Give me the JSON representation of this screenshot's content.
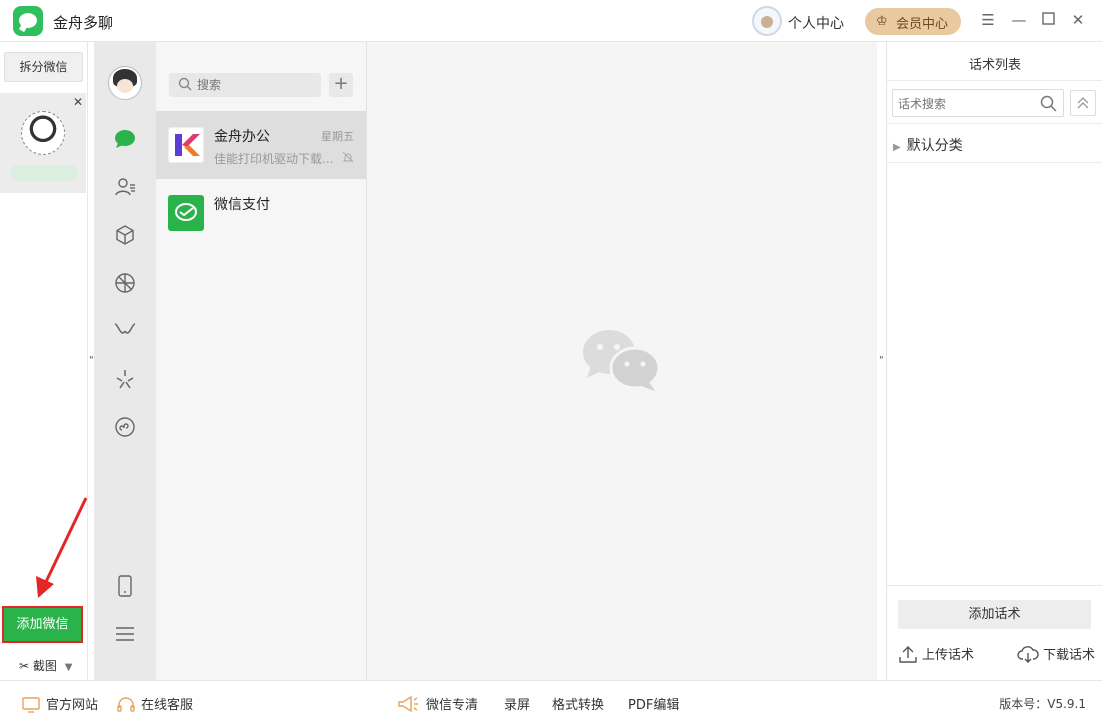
{
  "window": {
    "title": "金舟多聊",
    "personal_center": "个人中心",
    "vip_center": "会员中心"
  },
  "accounts": {
    "split_label": "拆分微信",
    "add_wechat": "添加微信",
    "screenshot": "截图"
  },
  "chatlist": {
    "search_placeholder": "搜索",
    "items": [
      {
        "name": "金舟办公",
        "preview": "佳能打印机驱动下载...",
        "time": "星期五"
      },
      {
        "name": "微信支付",
        "preview": "",
        "time": ""
      }
    ]
  },
  "phrases": {
    "title": "话术列表",
    "search_placeholder": "话术搜索",
    "category": "默认分类",
    "add_label": "添加话术",
    "upload_label": "上传话术",
    "download_label": "下载话术"
  },
  "bottom": {
    "official_site": "官方网站",
    "online_service": "在线客服",
    "wechat_hd": "微信专清",
    "record": "录屏",
    "convert": "格式转换",
    "pdf_edit": "PDF编辑",
    "version": "版本号：V5.9.1"
  },
  "colors": {
    "accent_green": "#2bb34b",
    "highlight_red": "#e52626",
    "vip_gold": "#e8c9a0"
  }
}
